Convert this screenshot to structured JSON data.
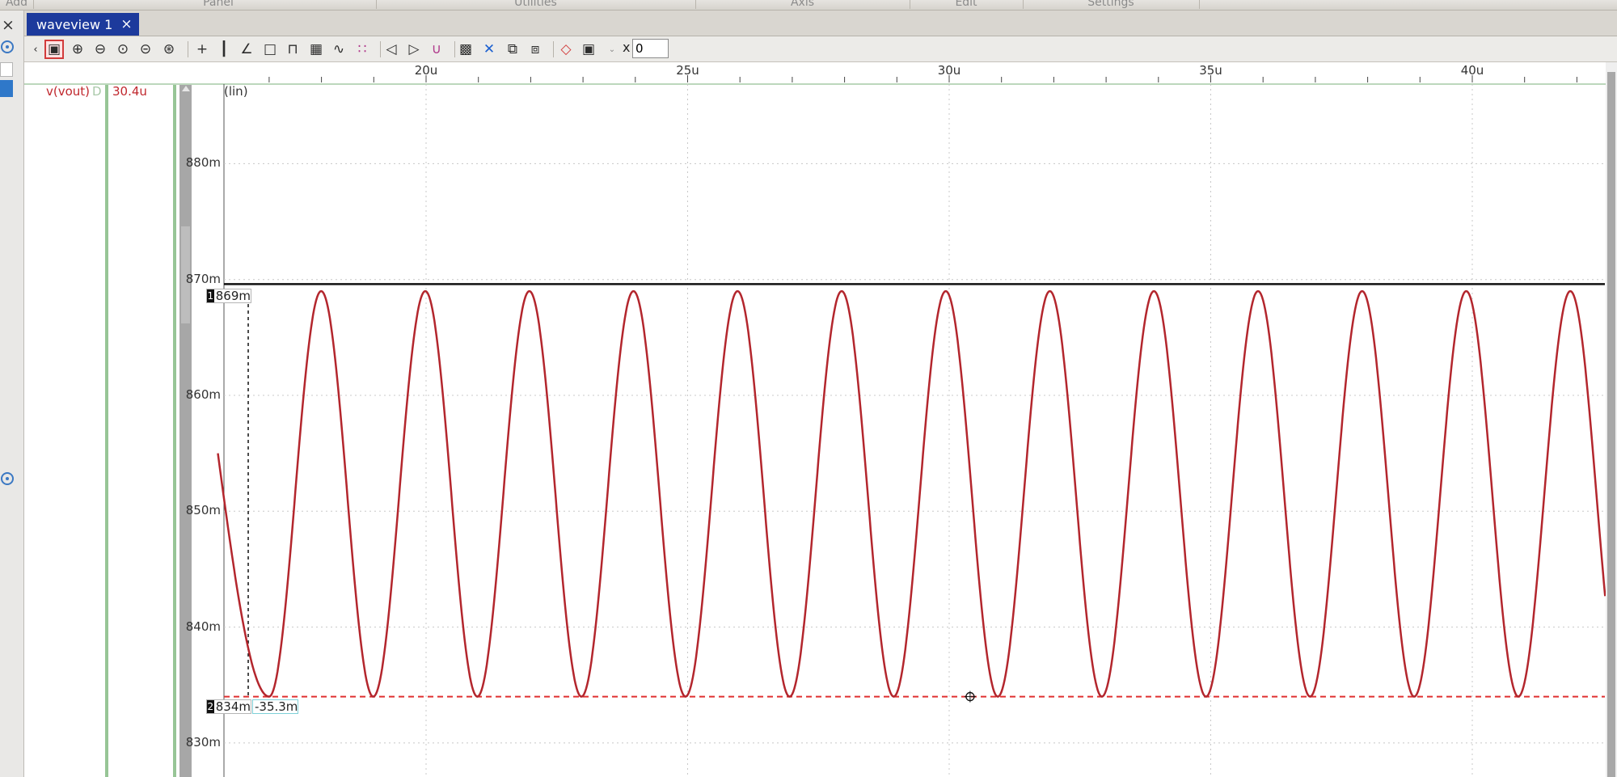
{
  "menubar": {
    "items": [
      "Add",
      "Panel",
      "Utilities",
      "Axis",
      "Edit",
      "Settings"
    ]
  },
  "dock": {
    "close_glyph": "×"
  },
  "tab": {
    "label": "waveview 1",
    "close_glyph": "×"
  },
  "toolbar": {
    "icons": [
      "scroll-left-icon",
      "select-zoom-icon",
      "zoom-in-icon",
      "zoom-out-icon",
      "zoom-fit-icon",
      "zoom-area-icon",
      "zoom-prev-icon",
      "cursor-icon",
      "vertical-bars-icon",
      "measure-icon",
      "annotation-icon",
      "pulse-icon",
      "grid-icon",
      "waveform-icon",
      "marker-icon",
      "prev-edge-icon",
      "next-edge-icon",
      "trigger-icon",
      "group-icon",
      "delete-icon",
      "copy-icon",
      "link-icon",
      "eraser-icon",
      "fit-window-icon",
      "more-icon"
    ],
    "x_label": "x",
    "x_value": "0"
  },
  "signal": {
    "name": "v(vout)",
    "flag": "D",
    "value": "30.4u",
    "color": "#b3262d"
  },
  "plot": {
    "scale_label": "(lin)",
    "grid_color": "#c8c8c8",
    "hline_color": "#111111",
    "min_line_color": "#e03030"
  },
  "markers": {
    "m1": {
      "index": "1",
      "value": "869m"
    },
    "m2": {
      "index": "2",
      "value": "834m",
      "delta": "-35.3m"
    }
  },
  "chart_data": {
    "type": "line",
    "series": [
      {
        "name": "v(vout)",
        "period_us": 1.99,
        "min_mV": 834,
        "max_mV": 869,
        "first_min_us": 17.0,
        "start_mV": 855
      }
    ],
    "x_unit": "u",
    "x_ticks": [
      "20u",
      "25u",
      "30u",
      "35u",
      "40u"
    ],
    "x_tick_values": [
      20,
      25,
      30,
      35,
      40
    ],
    "xlim": [
      16.0,
      42.6
    ],
    "y_ticks": [
      "880m",
      "870m",
      "860m",
      "850m",
      "840m",
      "830m"
    ],
    "y_tick_values": [
      880,
      870,
      860,
      850,
      840,
      830
    ],
    "ylim": [
      826.2,
      886.0
    ],
    "hline_mV": 869.6,
    "min_line_mV": 834.0,
    "cursor_x_us": 16.6
  }
}
